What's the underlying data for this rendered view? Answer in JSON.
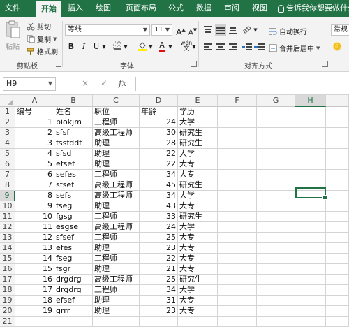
{
  "ribbon_tabs": [
    "文件",
    "开始",
    "插入",
    "绘图",
    "页面布局",
    "公式",
    "数据",
    "审阅",
    "视图"
  ],
  "tell_me": "告诉我你想要做什么",
  "clipboard": {
    "paste": "粘贴",
    "cut": "剪切",
    "copy": "复制",
    "format_painter": "格式刷",
    "group": "剪贴板"
  },
  "font": {
    "name": "等线",
    "size": "11",
    "bold": "B",
    "italic": "I",
    "underline": "U",
    "grow": "A",
    "shrink": "A",
    "wen": "wén",
    "color_letter": "A",
    "group": "字体"
  },
  "alignment": {
    "wrap_text": "自动换行",
    "merge_center": "合并后居中",
    "group": "对齐方式"
  },
  "number": {
    "format": "常规"
  },
  "formula_bar": {
    "name_box": "H9",
    "cancel": "×",
    "enter": "✓",
    "fx": "fx",
    "value": ""
  },
  "columns": [
    "A",
    "B",
    "C",
    "D",
    "E",
    "F",
    "G",
    "H"
  ],
  "selected": {
    "column": "H",
    "row": "9"
  },
  "table": {
    "header": [
      "编号",
      "姓名",
      "职位",
      "年龄",
      "学历"
    ],
    "rows": [
      [
        "1",
        "piokjm",
        "工程师",
        "24",
        "大学"
      ],
      [
        "2",
        "sfsf",
        "高级工程师",
        "30",
        "研究生"
      ],
      [
        "3",
        "fssfddf",
        "助理",
        "28",
        "研究生"
      ],
      [
        "4",
        "sfsd",
        "助理",
        "22",
        "大学"
      ],
      [
        "5",
        "efsef",
        "助理",
        "22",
        "大专"
      ],
      [
        "6",
        "sefes",
        "工程师",
        "34",
        "大专"
      ],
      [
        "7",
        "sfsef",
        "高级工程师",
        "45",
        "研究生"
      ],
      [
        "8",
        "sefs",
        "高级工程师",
        "34",
        "大学"
      ],
      [
        "9",
        "fseg",
        "助理",
        "43",
        "大专"
      ],
      [
        "10",
        "fgsg",
        "工程师",
        "33",
        "研究生"
      ],
      [
        "11",
        "esgse",
        "高级工程师",
        "24",
        "大学"
      ],
      [
        "12",
        "sfsef",
        "工程师",
        "25",
        "大专"
      ],
      [
        "13",
        "efes",
        "助理",
        "23",
        "大专"
      ],
      [
        "14",
        "fseg",
        "工程师",
        "22",
        "大专"
      ],
      [
        "15",
        "fsgr",
        "助理",
        "21",
        "大专"
      ],
      [
        "16",
        "drgdrg",
        "高级工程师",
        "25",
        "研究生"
      ],
      [
        "17",
        "drgdrg",
        "工程师",
        "34",
        "大学"
      ],
      [
        "18",
        "efsef",
        "助理",
        "31",
        "大专"
      ],
      [
        "19",
        "grrr",
        "助理",
        "23",
        "大专"
      ]
    ]
  },
  "colors": {
    "accent": "#217346",
    "font_color": "#e01010",
    "highlight": "#ffee00"
  }
}
